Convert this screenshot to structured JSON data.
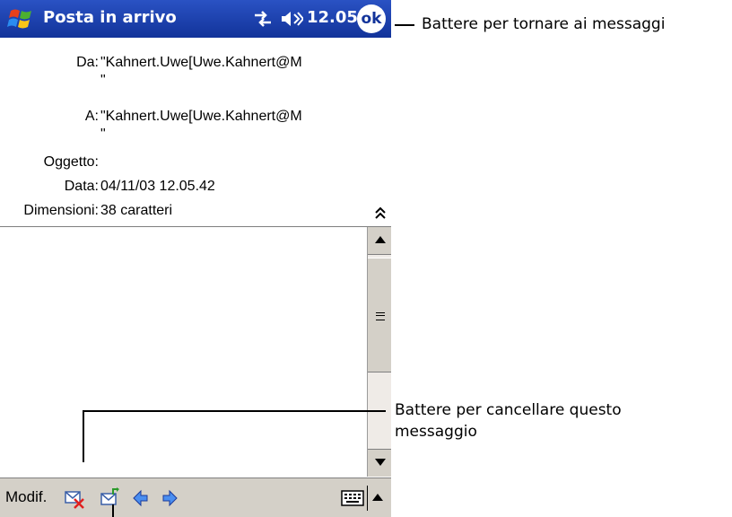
{
  "titlebar": {
    "app_title": "Posta in arrivo",
    "time": "12.05",
    "ok_label": "ok",
    "bg_color": "#1c3fa8"
  },
  "message": {
    "from_label": "Da:",
    "from_value": "\"Kahnert.Uwe[Uwe.Kahnert@M",
    "from_value_cont": "\"",
    "to_label": "A:",
    "to_value": "\"Kahnert.Uwe[Uwe.Kahnert@M",
    "to_value_cont": "\"",
    "subject_label": "Oggetto:",
    "subject_value": "",
    "date_label": "Data:",
    "date_value": "04/11/03 12.05.42",
    "size_label": "Dimensioni:",
    "size_value": "38 caratteri"
  },
  "menubar": {
    "edit_label": "Modif."
  },
  "annotations": {
    "ok_callout": "Battere per tornare ai messaggi",
    "delete_callout_line1": "Battere per cancellare questo",
    "delete_callout_line2": "messaggio"
  },
  "icons": [
    "windows-flag-icon",
    "connectivity-icon",
    "speaker-icon",
    "ok-icon",
    "collapse-header-icon",
    "delete-message-icon",
    "reply-icon",
    "previous-arrow-icon",
    "next-arrow-icon",
    "keyboard-icon",
    "sip-up-arrow-icon"
  ]
}
